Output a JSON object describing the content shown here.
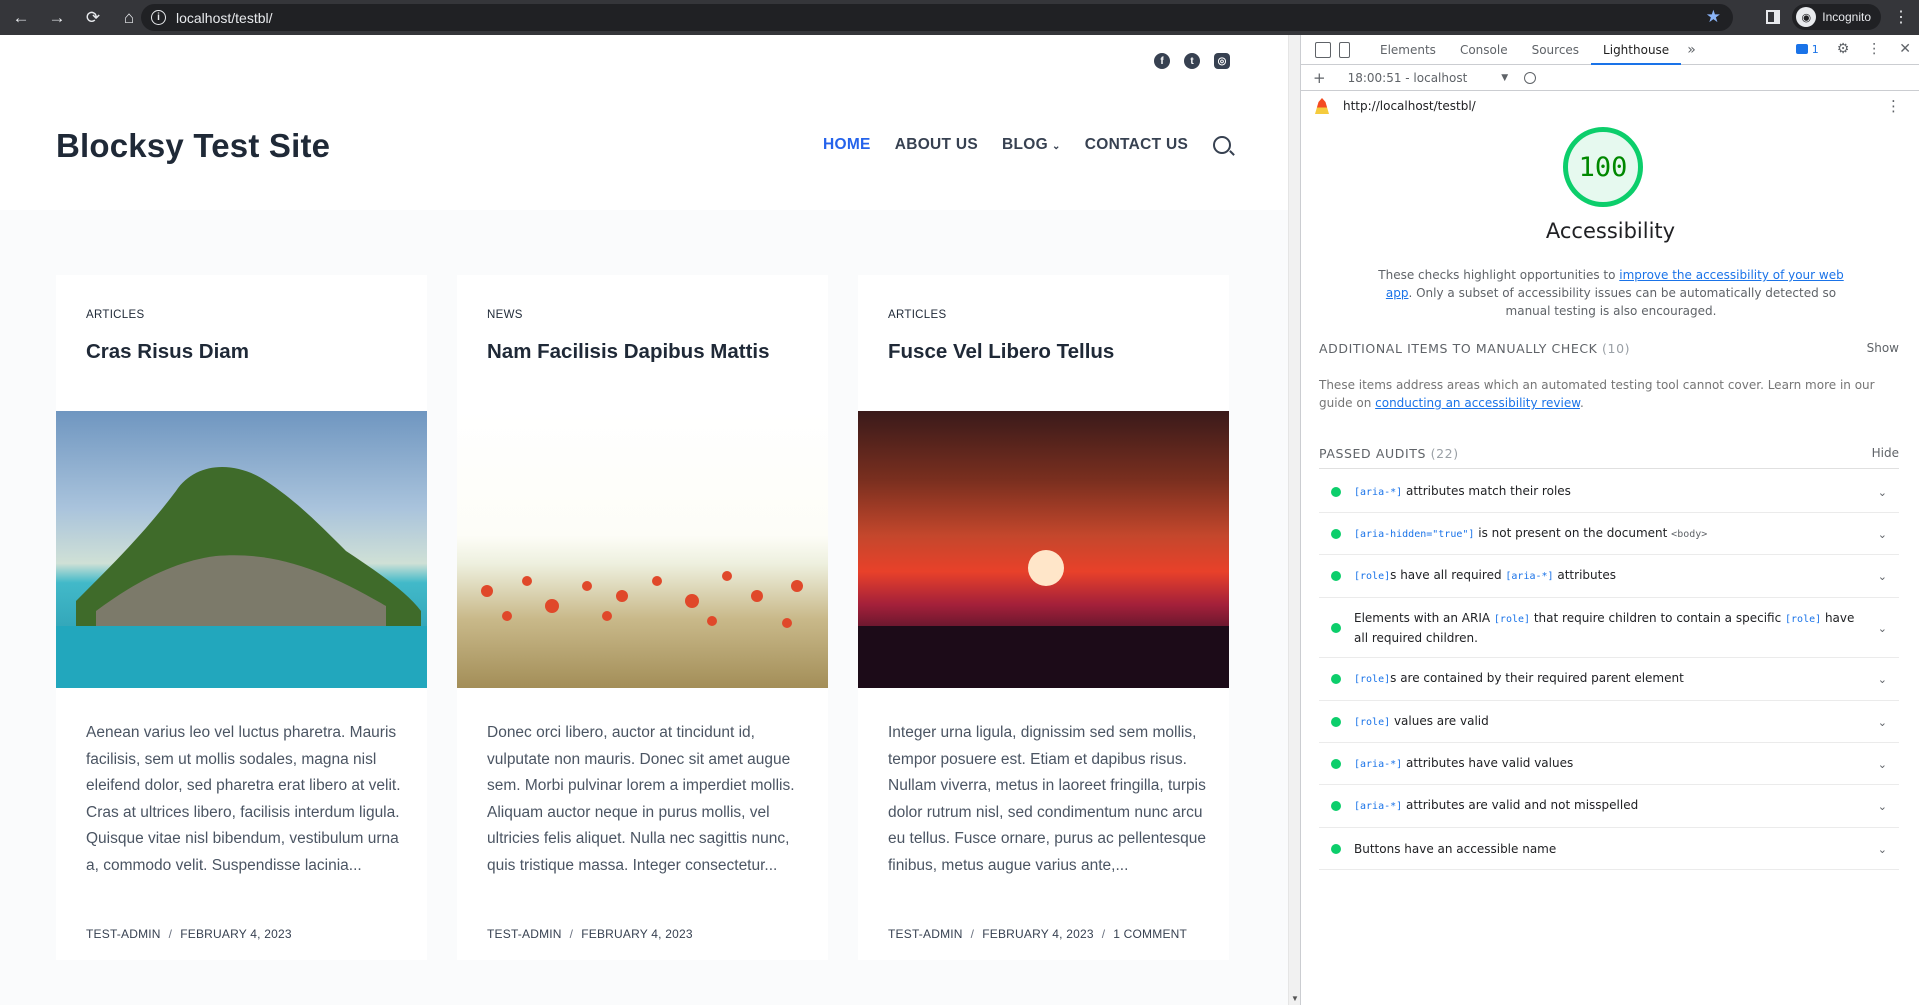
{
  "browser": {
    "url": "localhost/testbl/",
    "profile_label": "Incognito",
    "icons": [
      "back-arrow-icon",
      "forward-arrow-icon",
      "reload-icon",
      "home-icon",
      "info-icon",
      "star-icon",
      "side-panel-icon",
      "incognito-icon",
      "kebab-menu-icon"
    ]
  },
  "site": {
    "title": "Blocksy Test Site",
    "social_icons": [
      "facebook-icon",
      "twitter-icon",
      "instagram-icon"
    ],
    "nav": [
      {
        "label": "HOME",
        "active": true
      },
      {
        "label": "ABOUT US",
        "active": false
      },
      {
        "label": "BLOG",
        "active": false,
        "has_dropdown": true
      },
      {
        "label": "CONTACT US",
        "active": false
      }
    ],
    "posts": [
      {
        "category": "ARTICLES",
        "title": "Cras Risus Diam",
        "excerpt": "Aenean varius leo vel luctus pharetra. Mauris facilisis, sem ut mollis sodales, magna nisl eleifend dolor, sed pharetra erat libero at velit. Cras at ultrices libero, facilisis interdum ligula. Quisque vitae nisl bibendum, vestibulum urna a, commodo velit. Suspendisse lacinia...",
        "author": "TEST-ADMIN",
        "date": "FEBRUARY 4, 2023",
        "comments": ""
      },
      {
        "category": "NEWS",
        "title": "Nam Facilisis Dapibus Mattis",
        "excerpt": "Donec orci libero, auctor at tincidunt id, vulputate non mauris. Donec sit amet augue sem. Morbi pulvinar lorem a imperdiet mollis. Aliquam auctor neque in purus mollis, vel ultricies felis aliquet. Nulla nec sagittis nunc, quis tristique massa. Integer consectetur...",
        "author": "TEST-ADMIN",
        "date": "FEBRUARY 4, 2023",
        "comments": ""
      },
      {
        "category": "ARTICLES",
        "title": "Fusce Vel Libero Tellus",
        "excerpt": "Integer urna ligula, dignissim sed sem mollis, tempor posuere est. Etiam et dapibus risus. Nullam viverra, metus in laoreet fringilla, turpis dolor rutrum nisl, sed condimentum nunc arcu eu tellus. Fusce ornare, purus ac pellentesque finibus, metus augue varius ante,...",
        "author": "TEST-ADMIN",
        "date": "FEBRUARY 4, 2023",
        "comments": "1 COMMENT"
      }
    ]
  },
  "devtools": {
    "tabs": [
      "Elements",
      "Console",
      "Sources",
      "Lighthouse"
    ],
    "active_tab": "Lighthouse",
    "more_tabs": "»",
    "issues_count": "1",
    "report_label": "18:00:51 - localhost",
    "report_url": "http://localhost/testbl/",
    "score": "100",
    "score_color": "#0cce6b",
    "category": "Accessibility",
    "desc_pre": "These checks highlight opportunities to ",
    "desc_link": "improve the accessibility of your web app",
    "desc_post": ". Only a subset of accessibility issues can be automatically detected so manual testing is also encouraged.",
    "manual": {
      "title": "ADDITIONAL ITEMS TO MANUALLY CHECK",
      "count": "(10)",
      "toggle": "Show",
      "desc_pre": "These items address areas which an automated testing tool cannot cover. Learn more in our guide on ",
      "desc_link": "conducting an accessibility review",
      "desc_post": "."
    },
    "passed": {
      "title": "PASSED AUDITS",
      "count": "(22)",
      "toggle": "Hide"
    },
    "audits": [
      {
        "parts": [
          {
            "code": "[aria-*]"
          },
          {
            "text": " attributes match their roles"
          }
        ]
      },
      {
        "parts": [
          {
            "code": "[aria-hidden=\"true\"]"
          },
          {
            "text": " is not present on the document "
          },
          {
            "code": "<body>",
            "grey": true
          }
        ]
      },
      {
        "parts": [
          {
            "code": "[role]"
          },
          {
            "text": "s have all required "
          },
          {
            "code": "[aria-*]"
          },
          {
            "text": " attributes"
          }
        ]
      },
      {
        "parts": [
          {
            "text": "Elements with an ARIA "
          },
          {
            "code": "[role]"
          },
          {
            "text": " that require children to contain a specific "
          },
          {
            "code": "[role]"
          },
          {
            "text": " have all required children."
          }
        ]
      },
      {
        "parts": [
          {
            "code": "[role]"
          },
          {
            "text": "s are contained by their required parent element"
          }
        ]
      },
      {
        "parts": [
          {
            "code": "[role]"
          },
          {
            "text": " values are valid"
          }
        ]
      },
      {
        "parts": [
          {
            "code": "[aria-*]"
          },
          {
            "text": " attributes have valid values"
          }
        ]
      },
      {
        "parts": [
          {
            "code": "[aria-*]"
          },
          {
            "text": " attributes are valid and not misspelled"
          }
        ]
      },
      {
        "parts": [
          {
            "text": "Buttons have an accessible name"
          }
        ]
      }
    ]
  }
}
